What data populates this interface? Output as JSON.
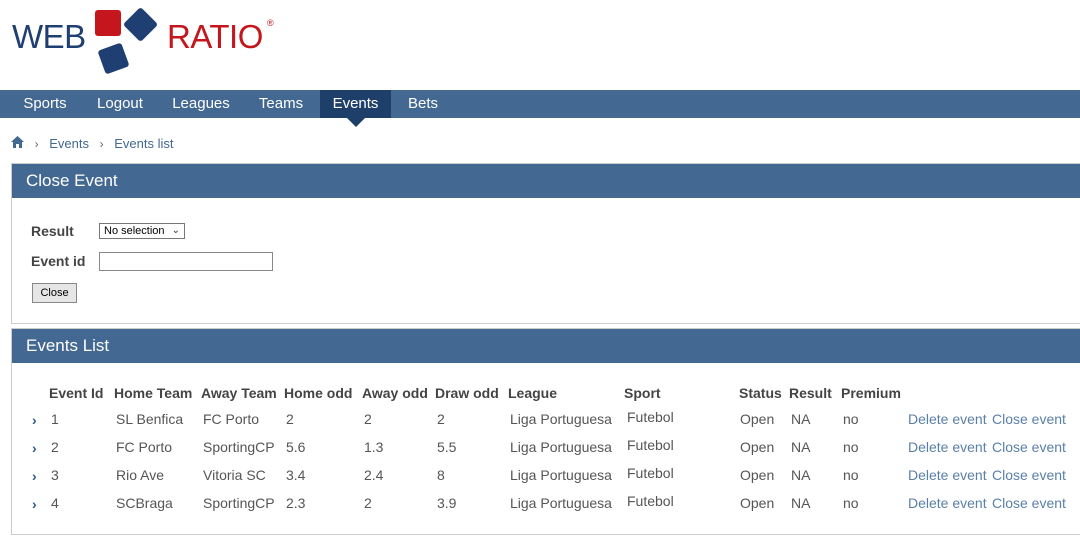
{
  "logo": {
    "left": "WEB",
    "right": "RATIO",
    "reg": "®"
  },
  "nav": {
    "items": [
      "Sports",
      "Logout",
      "Leagues",
      "Teams",
      "Events",
      "Bets"
    ],
    "active": "Events"
  },
  "breadcrumb": {
    "items": [
      "Events",
      "Events list"
    ]
  },
  "close_event": {
    "title": "Close Event",
    "result_label": "Result",
    "result_value": "No selection",
    "event_id_label": "Event id",
    "event_id_value": "",
    "button": "Close"
  },
  "events_list": {
    "title": "Events List",
    "columns": [
      "Event Id",
      "Home Team",
      "Away Team",
      "Home odd",
      "Away odd",
      "Draw odd",
      "League",
      "Sport",
      "Status",
      "Result",
      "Premium"
    ],
    "rows": [
      {
        "id": "1",
        "home": "SL Benfica",
        "away": "FC Porto",
        "home_odd": "2",
        "away_odd": "2",
        "draw_odd": "2",
        "league": "Liga Portuguesa",
        "sport": "Futebol",
        "status": "Open",
        "result": "NA",
        "premium": "no",
        "delete": "Delete event",
        "close": "Close event"
      },
      {
        "id": "2",
        "home": "FC Porto",
        "away": "SportingCP",
        "home_odd": "5.6",
        "away_odd": "1.3",
        "draw_odd": "5.5",
        "league": "Liga Portuguesa",
        "sport": "Futebol",
        "status": "Open",
        "result": "NA",
        "premium": "no",
        "delete": "Delete event",
        "close": "Close event"
      },
      {
        "id": "3",
        "home": "Rio Ave",
        "away": "Vitoria SC",
        "home_odd": "3.4",
        "away_odd": "2.4",
        "draw_odd": "8",
        "league": "Liga Portuguesa",
        "sport": "Futebol",
        "status": "Open",
        "result": "NA",
        "premium": "no",
        "delete": "Delete event",
        "close": "Close event"
      },
      {
        "id": "4",
        "home": "SCBraga",
        "away": "SportingCP",
        "home_odd": "2.3",
        "away_odd": "2",
        "draw_odd": "3.9",
        "league": "Liga Portuguesa",
        "sport": "Futebol",
        "status": "Open",
        "result": "NA",
        "premium": "no",
        "delete": "Delete event",
        "close": "Close event"
      }
    ]
  },
  "colors": {
    "nav": "#436891",
    "nav_active": "#1f3f6b",
    "brand_blue": "#1f3f73",
    "brand_red": "#c4161c",
    "link": "#5a7fa8"
  }
}
